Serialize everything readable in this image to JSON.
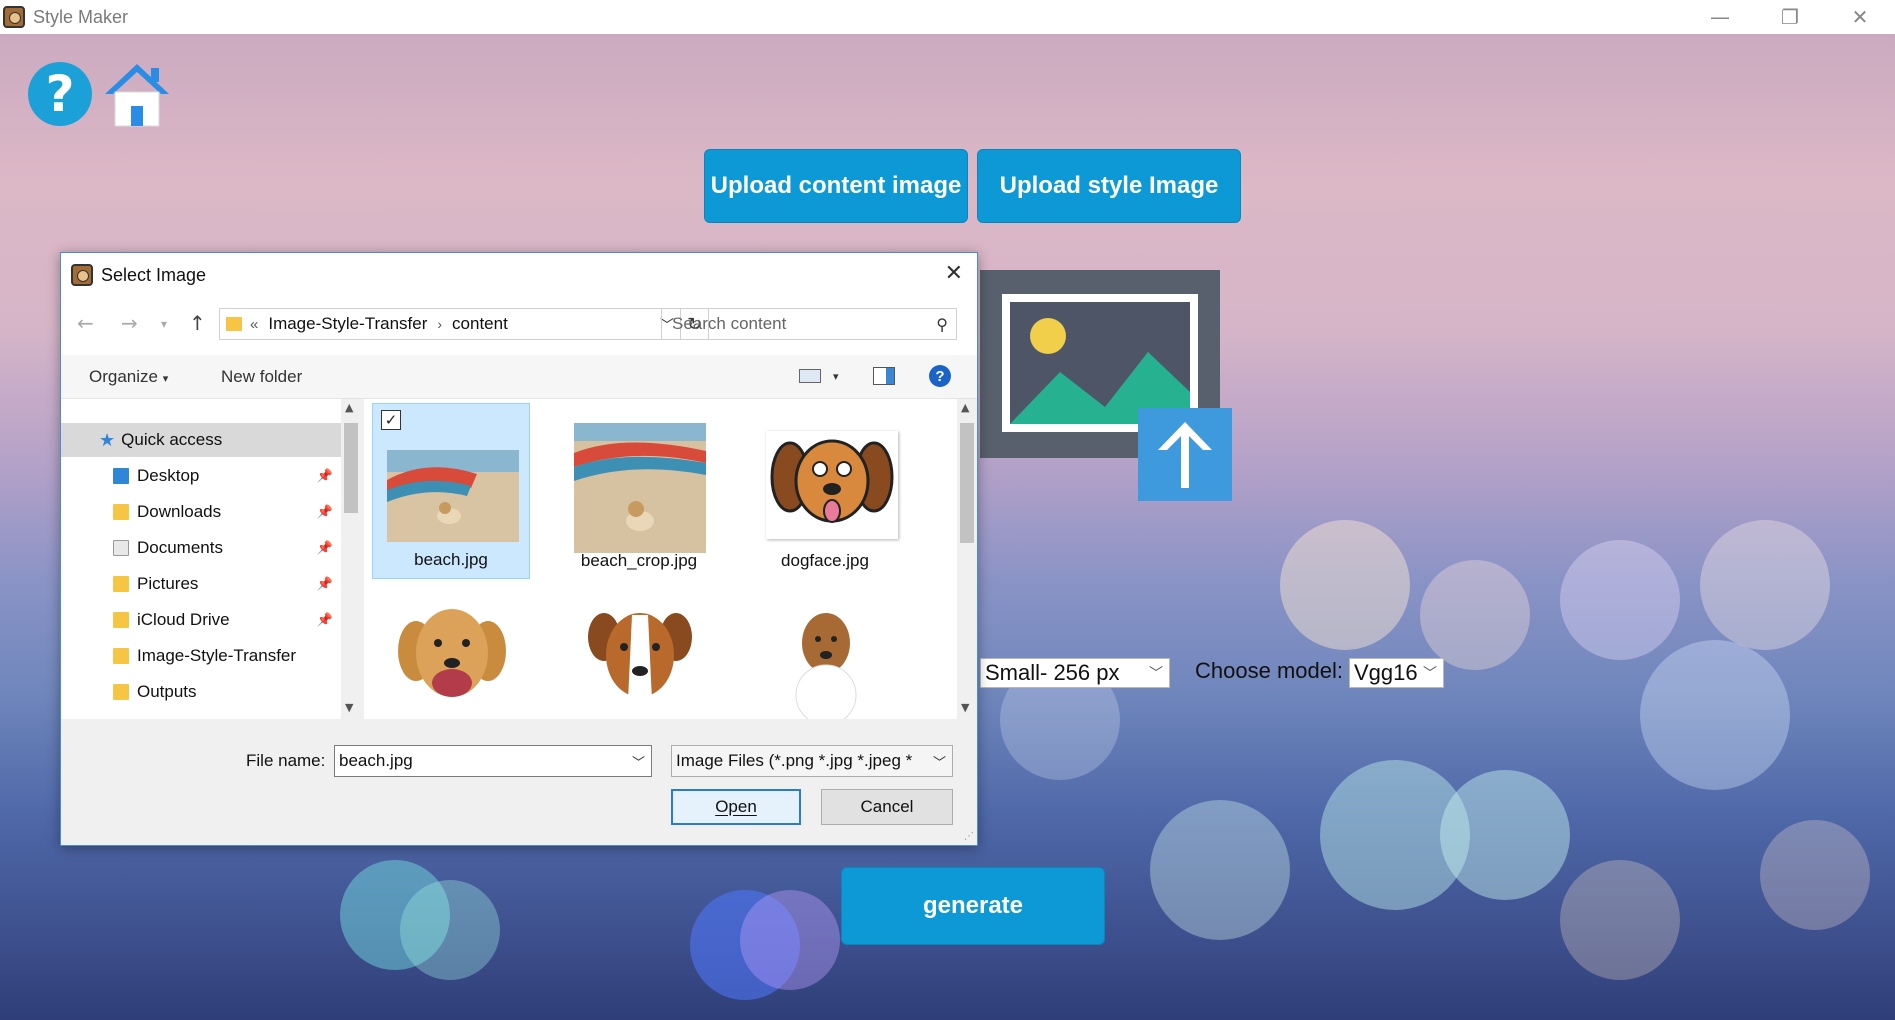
{
  "window": {
    "title": "Style Maker"
  },
  "top_icons": {
    "help": "?"
  },
  "buttons": {
    "upload_content": "Upload content image",
    "upload_style": "Upload style Image",
    "generate": "generate"
  },
  "controls": {
    "size_value": "Small- 256 px",
    "model_label": "Choose model:",
    "model_value": "Vgg16"
  },
  "dialog": {
    "title": "Select Image",
    "address": {
      "prefix": "«",
      "path": [
        "Image-Style-Transfer",
        "content"
      ]
    },
    "search_placeholder": "Search content",
    "toolbar": {
      "organize": "Organize",
      "new_folder": "New folder"
    },
    "nav": [
      {
        "label": "Quick access",
        "type": "quick",
        "selected": true
      },
      {
        "label": "Desktop",
        "pinned": true
      },
      {
        "label": "Downloads",
        "pinned": true
      },
      {
        "label": "Documents",
        "pinned": true
      },
      {
        "label": "Pictures",
        "pinned": true
      },
      {
        "label": "iCloud Drive",
        "pinned": true
      },
      {
        "label": "Image-Style-Transfer",
        "pinned": false
      },
      {
        "label": "Outputs",
        "pinned": false
      }
    ],
    "files": [
      {
        "name": "beach.jpg",
        "selected": true,
        "checked": true
      },
      {
        "name": "beach_crop.jpg"
      },
      {
        "name": "dogface.jpg"
      }
    ],
    "file_name_label": "File name:",
    "file_name_value": "beach.jpg",
    "file_type": "Image Files (*.png *.jpg *.jpeg *",
    "open_label": "Open",
    "cancel_label": "Cancel"
  },
  "colors": {
    "accent": "#0d99d6",
    "dialog_border": "#4b8cd8",
    "selection": "#cce8ff"
  }
}
